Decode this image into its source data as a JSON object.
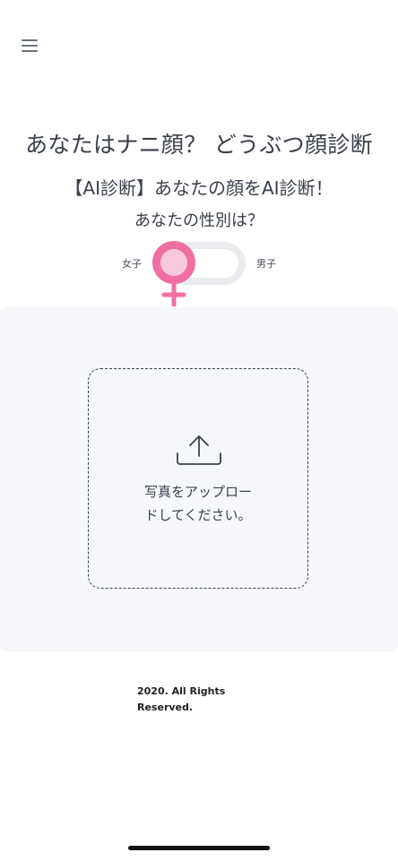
{
  "menu": {
    "icon": "hamburger-menu-icon"
  },
  "header": {
    "title": "あなたはナニ顔？ どうぶつ顔診断",
    "subtitle": "【AI診断】あなたの顔をAI診断！",
    "question": "あなたの性別は？"
  },
  "gender_toggle": {
    "female_label": "女子",
    "male_label": "男子",
    "selected": "女子",
    "icon": "female-symbol-icon",
    "accent_color": "#f06ea1",
    "knob_color": "#f8c9dc",
    "track_color": "#e9ebee"
  },
  "upload": {
    "icon": "upload-icon",
    "text_line1": "写真をアップロー",
    "text_line2": "ドしてください。"
  },
  "footer": {
    "line1": "2020. All Rights",
    "line2": "Reserved."
  }
}
